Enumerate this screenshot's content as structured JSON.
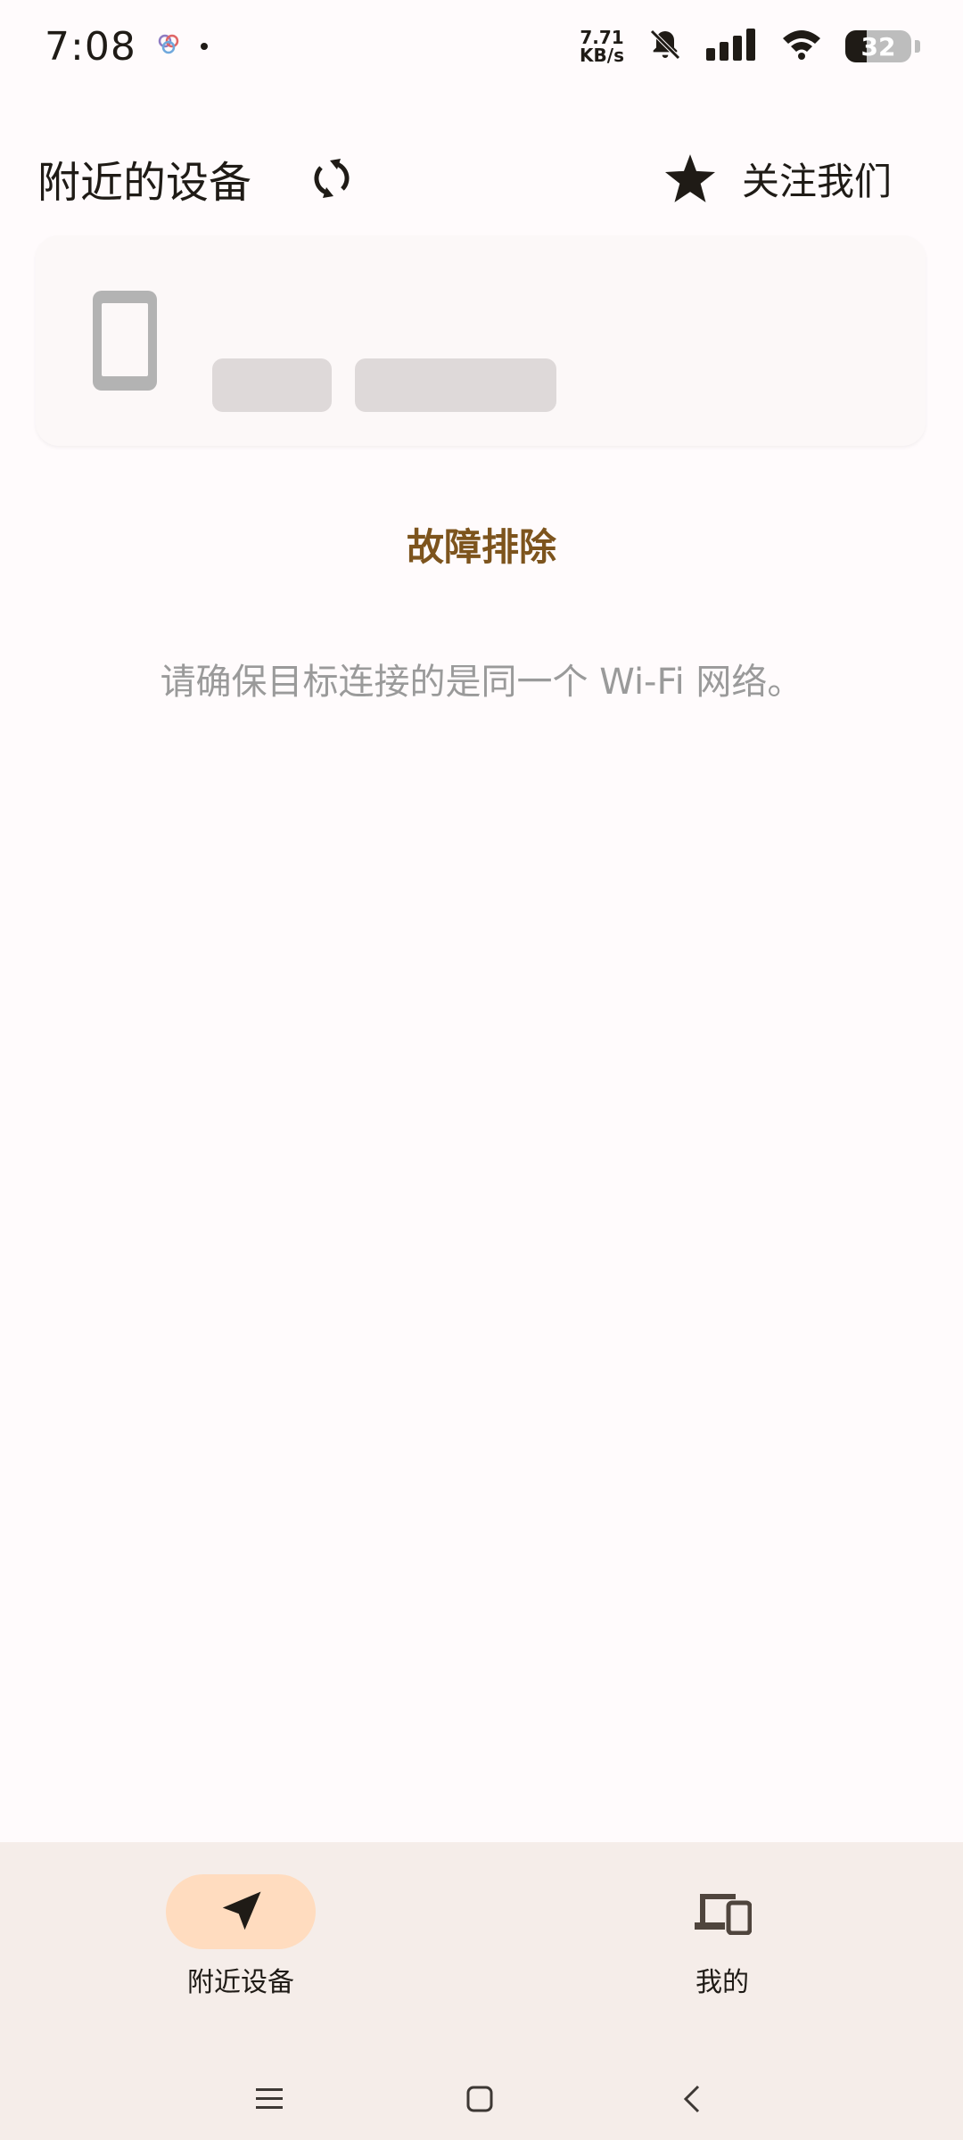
{
  "status_bar": {
    "time": "7:08",
    "net_speed_value": "7.71",
    "net_speed_unit": "KB/s",
    "battery_percent": "32",
    "battery_level": 0.32
  },
  "header": {
    "title": "附近的设备",
    "follow_label": "关注我们"
  },
  "troubleshoot": {
    "title": "故障排除",
    "hint": "请确保目标连接的是同一个 Wi-Fi 网络。"
  },
  "bottom_nav": {
    "items": [
      {
        "label": "附近设备",
        "icon": "navigation-arrow-icon",
        "active": true
      },
      {
        "label": "我的",
        "icon": "devices-icon",
        "active": false
      }
    ]
  },
  "colors": {
    "accent_text": "#7d541d",
    "active_pill": "#ffdcbf",
    "nav_background": "#f5ede9",
    "page_background": "#fffbfc"
  }
}
